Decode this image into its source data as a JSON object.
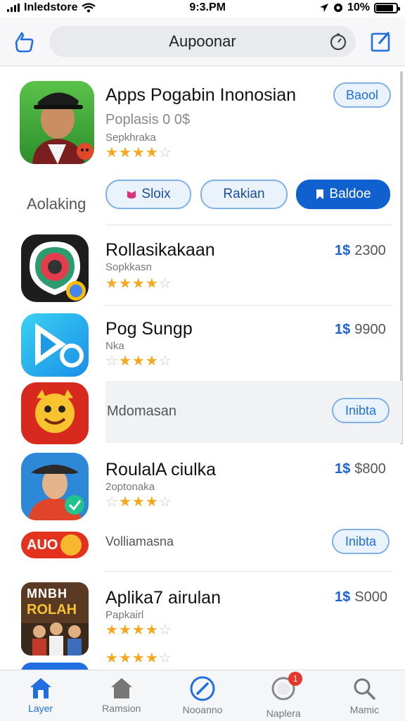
{
  "status_bar": {
    "carrier": "Inledstore",
    "time": "9:3.PM",
    "battery": "10%"
  },
  "nav": {
    "search_text": "Aupoonar"
  },
  "featured": {
    "title": "Apps Pogabin Inonosian",
    "subtitle": "Poplasis 0 0$",
    "developer": "Sepkhraka",
    "rating": 4,
    "get_label": "Baool",
    "left_label": "Aolaking",
    "buttons": {
      "b1": "Sloix",
      "b2": "Rakian",
      "b3": "Baldoe"
    }
  },
  "apps": [
    {
      "title": "Rollasikakaan",
      "sub": "Sopkkasn",
      "currency": "1$",
      "amount": "2300",
      "rating": 4
    },
    {
      "title": "Pog Sungp",
      "sub": "Nka",
      "currency": "1$",
      "amount": "9900",
      "rating": 4
    },
    {
      "title": "Mdomasan",
      "button": "Inibta"
    },
    {
      "title": "RoulalA ciulka",
      "sub": "2optonaka",
      "currency": "1$",
      "amount": "$800",
      "rating": 4
    },
    {
      "title": "Volliamasna",
      "button": "Inibta",
      "icon_text": "AUO"
    },
    {
      "title": "Aplika7 airulan",
      "sub": "Papkairl",
      "currency": "1$",
      "amount": "S000",
      "rating": 4,
      "icon_text_top": "MNBH",
      "icon_text_bottom": "ROLAH"
    }
  ],
  "tabs": [
    {
      "label": "Layer",
      "active": true
    },
    {
      "label": "Ramsion"
    },
    {
      "label": "Nooanno"
    },
    {
      "label": "Naplera",
      "badge": "1"
    },
    {
      "label": "Mamic"
    }
  ],
  "colors": {
    "accent": "#1060d0",
    "star": "#f4a81c",
    "badge": "#e5372c"
  }
}
